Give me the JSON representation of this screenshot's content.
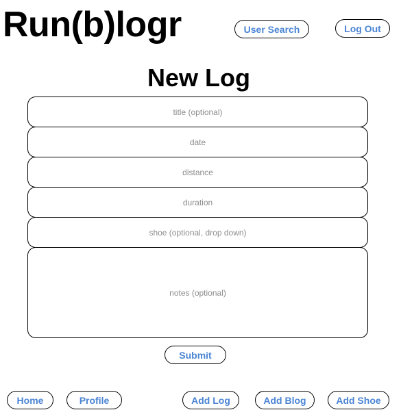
{
  "header": {
    "logo": "Run(b)logr",
    "user_search_label": "User Search",
    "logout_label": "Log Out"
  },
  "page": {
    "title": "New Log"
  },
  "form": {
    "fields": [
      {
        "placeholder": "title (optional)"
      },
      {
        "placeholder": "date"
      },
      {
        "placeholder": "distance"
      },
      {
        "placeholder": "duration"
      },
      {
        "placeholder": "shoe (optional, drop down)"
      },
      {
        "placeholder": "notes (optional)"
      }
    ],
    "submit_label": "Submit"
  },
  "footer": {
    "home_label": "Home",
    "profile_label": "Profile",
    "add_log_label": "Add Log",
    "add_blog_label": "Add Blog",
    "add_shoe_label": "Add Shoe"
  },
  "colors": {
    "link_text": "#4a84d4",
    "placeholder_text": "#8c8c8c",
    "border": "#000000"
  }
}
